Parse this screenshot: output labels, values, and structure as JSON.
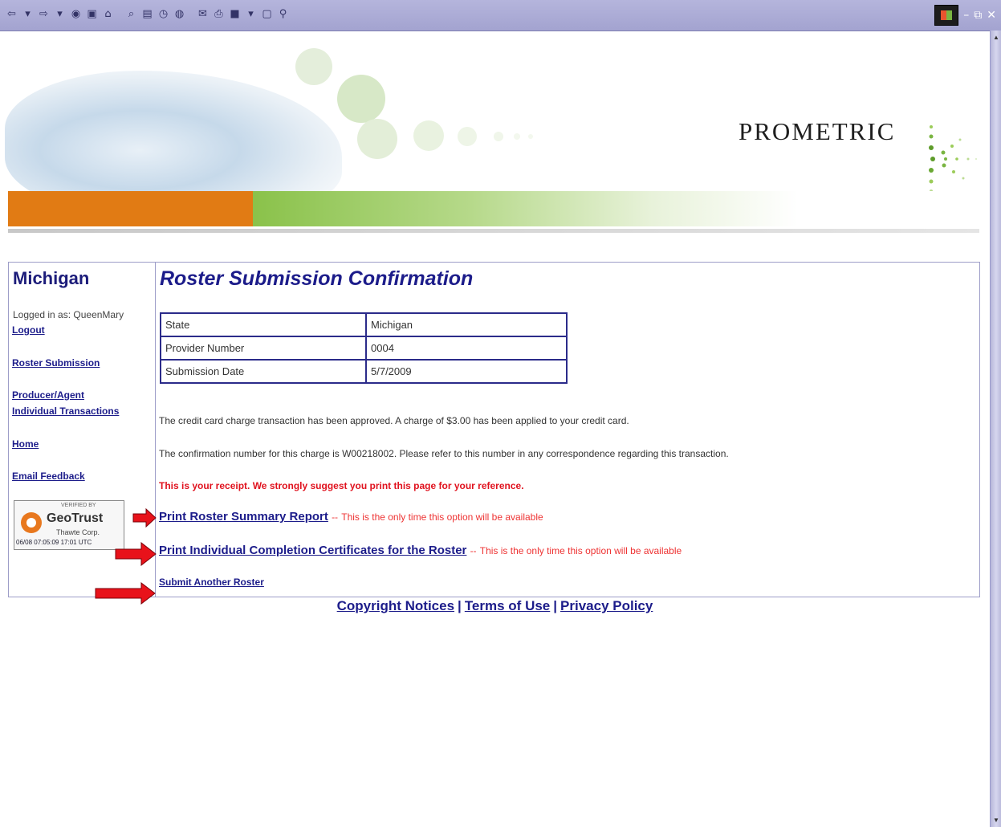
{
  "browser": {
    "toolbar_icons": [
      "back-icon",
      "forward-icon",
      "stop-icon",
      "refresh-icon",
      "home-icon",
      "search-icon",
      "favorites-icon",
      "history-icon",
      "mail-icon",
      "print-icon",
      "edit-icon",
      "discuss-icon",
      "messenger-icon"
    ],
    "window_controls": [
      "minimize-icon",
      "restore-icon",
      "close-icon"
    ]
  },
  "header": {
    "logo_text": "PROMETRIC",
    "colors": {
      "orange": "#e17b14",
      "green": "#8ac24a"
    }
  },
  "sidebar": {
    "title": "Michigan",
    "logged_in": "Logged in as: QueenMary",
    "links": {
      "logout": "Logout",
      "roster_submission": "Roster Submission",
      "producer_line1": "Producer/Agent",
      "producer_line2": "Individual Transactions",
      "home": "Home",
      "email_feedback": "Email Feedback"
    },
    "badge": {
      "verified": "VERIFIED BY",
      "name": "GeoTrust",
      "corp": "Thawte Corp.",
      "date": "06/08 07:05:09 17:01 UTC"
    }
  },
  "main": {
    "title": "Roster Submission Confirmation",
    "table": [
      {
        "label": "State",
        "value": "Michigan"
      },
      {
        "label": "Provider Number",
        "value": "0004"
      },
      {
        "label": "Submission Date",
        "value": "5/7/2009"
      }
    ],
    "message_charge": "The credit card charge transaction has been approved. A charge of $3.00 has been applied to your credit card.",
    "message_confirmation": "The confirmation number for this charge is W00218002. Please refer to this number in any correspondence regarding this transaction.",
    "receipt_notice": "This is your receipt. We strongly suggest you print this page for your reference.",
    "actions": {
      "print_summary": "Print Roster Summary Report",
      "print_certificates": "Print Individual Completion Certificates for the Roster",
      "separator": "--",
      "note": "This is the only time this option will be available",
      "submit_another": "Submit Another Roster"
    },
    "arrow_color": "#e8121a"
  },
  "footer": {
    "copyright": "Copyright Notices",
    "terms": "Terms of Use",
    "privacy": "Privacy Policy",
    "separator": "|"
  }
}
